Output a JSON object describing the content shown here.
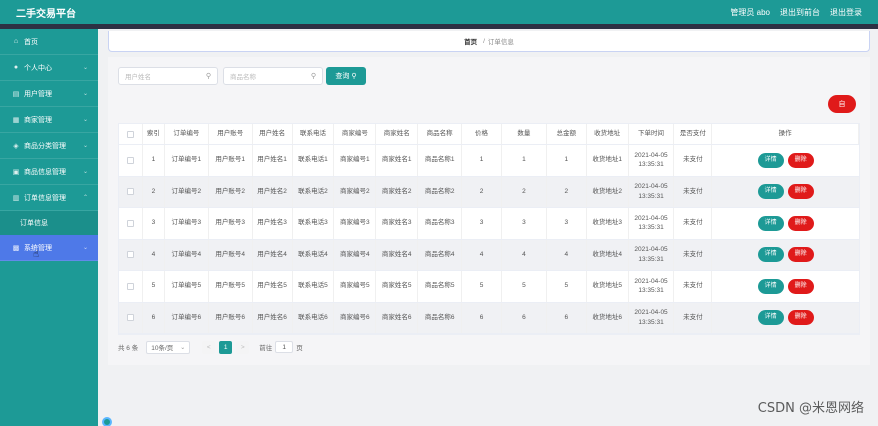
{
  "app": {
    "title": "二手交易平台"
  },
  "header": {
    "links": [
      "管理员 abo",
      "退出到前台",
      "退出登录"
    ]
  },
  "sidebar": {
    "items": [
      {
        "label": "首页",
        "icon": "home-icon",
        "has_chevron": false
      },
      {
        "label": "个人中心",
        "icon": "user-icon",
        "has_chevron": true
      },
      {
        "label": "用户管理",
        "icon": "list-icon",
        "has_chevron": true
      },
      {
        "label": "商家管理",
        "icon": "shop-icon",
        "has_chevron": true
      },
      {
        "label": "商品分类管理",
        "icon": "tag-icon",
        "has_chevron": true
      },
      {
        "label": "商品信息管理",
        "icon": "box-icon",
        "has_chevron": true
      },
      {
        "label": "订单信息管理",
        "icon": "order-icon",
        "has_chevron": true
      }
    ],
    "sub_item": "订单信息",
    "active_item": {
      "label": "系统管理",
      "icon": "settings-icon"
    }
  },
  "breadcrumb": {
    "home": "首页",
    "separator": "/",
    "current": "订单信息"
  },
  "search": {
    "user_name_placeholder": "用户姓名",
    "product_name_placeholder": "商品名称",
    "button": "查询"
  },
  "actions": {
    "delete_label": "自"
  },
  "table": {
    "headers": [
      "",
      "索引",
      "订单编号",
      "用户账号",
      "用户姓名",
      "联系电话",
      "商家编号",
      "商家姓名",
      "商品名称",
      "价格",
      "数量",
      "总金额",
      "收货地址",
      "下单时间",
      "是否支付",
      "操作"
    ],
    "rows": [
      [
        "1",
        "订单编号1",
        "用户账号1",
        "用户姓名1",
        "联系电话1",
        "商家编号1",
        "商家姓名1",
        "商品名称1",
        "1",
        "1",
        "1",
        "收货地址1",
        "2021-04-05 13:35:31",
        "未支付"
      ],
      [
        "2",
        "订单编号2",
        "用户账号2",
        "用户姓名2",
        "联系电话2",
        "商家编号2",
        "商家姓名2",
        "商品名称2",
        "2",
        "2",
        "2",
        "收货地址2",
        "2021-04-05 13:35:31",
        "未支付"
      ],
      [
        "3",
        "订单编号3",
        "用户账号3",
        "用户姓名3",
        "联系电话3",
        "商家编号3",
        "商家姓名3",
        "商品名称3",
        "3",
        "3",
        "3",
        "收货地址3",
        "2021-04-05 13:35:31",
        "未支付"
      ],
      [
        "4",
        "订单编号4",
        "用户账号4",
        "用户姓名4",
        "联系电话4",
        "商家编号4",
        "商家姓名4",
        "商品名称4",
        "4",
        "4",
        "4",
        "收货地址4",
        "2021-04-05 13:35:31",
        "未支付"
      ],
      [
        "5",
        "订单编号5",
        "用户账号5",
        "用户姓名5",
        "联系电话5",
        "商家编号5",
        "商家姓名5",
        "商品名称5",
        "5",
        "5",
        "5",
        "收货地址5",
        "2021-04-05 13:35:31",
        "未支付"
      ],
      [
        "6",
        "订单编号6",
        "用户账号6",
        "用户姓名6",
        "联系电话6",
        "商家编号6",
        "商家姓名6",
        "商品名称6",
        "6",
        "6",
        "6",
        "收货地址6",
        "2021-04-05 13:35:31",
        "未支付"
      ]
    ],
    "detail_label": "详情",
    "delete_label": "删除"
  },
  "pagination": {
    "total": "共 6 条",
    "page_size": "10条/页",
    "prev": "<",
    "current_page": "1",
    "next": ">",
    "goto_prefix": "前往",
    "goto_value": "1",
    "goto_suffix": "页"
  },
  "watermark": "CSDN @米恩网络",
  "colors": {
    "primary": "#1d9a96",
    "danger": "#e01a1a",
    "active_menu": "#4e79e8",
    "strip": "#2d3144"
  }
}
